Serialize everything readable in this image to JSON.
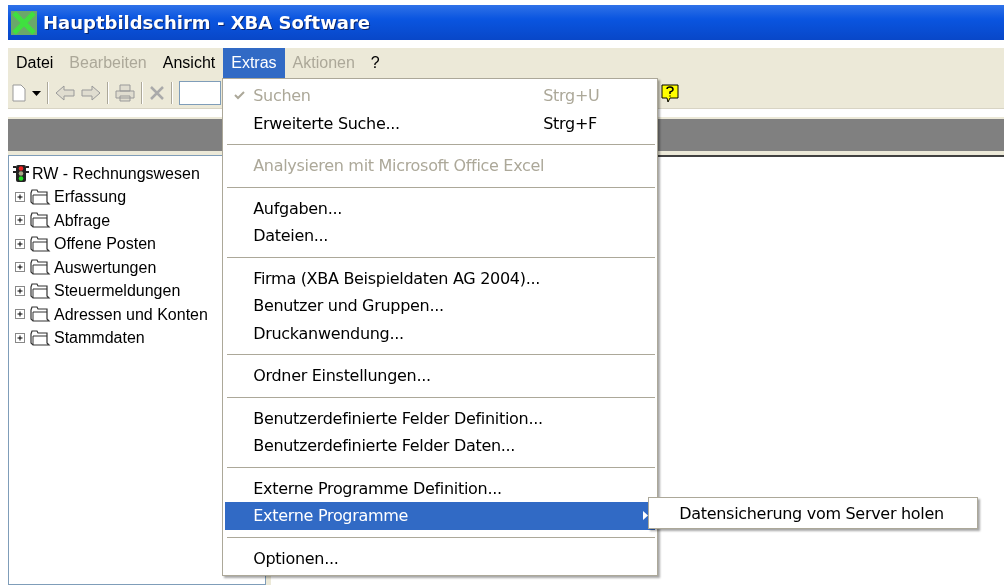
{
  "window": {
    "title": "Hauptbildschirm - XBA Software"
  },
  "menu_bar": [
    {
      "label": "Datei",
      "disabled": false,
      "selected": false
    },
    {
      "label": "Bearbeiten",
      "disabled": true,
      "selected": false
    },
    {
      "label": "Ansicht",
      "disabled": false,
      "selected": false
    },
    {
      "label": "Extras",
      "disabled": false,
      "selected": true
    },
    {
      "label": "Aktionen",
      "disabled": true,
      "selected": false
    },
    {
      "label": "?",
      "disabled": false,
      "selected": false
    }
  ],
  "extras_menu": [
    {
      "kind": "item",
      "label": "Suchen",
      "shortcut": "Strg+U",
      "disabled": true,
      "checked": true,
      "selected": false,
      "submenu": false
    },
    {
      "kind": "item",
      "label": "Erweiterte Suche...",
      "shortcut": "Strg+F",
      "disabled": false,
      "checked": false,
      "selected": false,
      "submenu": false
    },
    {
      "kind": "separator"
    },
    {
      "kind": "item",
      "label": "Analysieren mit Microsoft Office Excel",
      "disabled": true,
      "checked": false,
      "selected": false,
      "submenu": false
    },
    {
      "kind": "separator"
    },
    {
      "kind": "item",
      "label": "Aufgaben...",
      "disabled": false,
      "checked": false,
      "selected": false,
      "submenu": false
    },
    {
      "kind": "item",
      "label": "Dateien...",
      "disabled": false,
      "checked": false,
      "selected": false,
      "submenu": false
    },
    {
      "kind": "separator"
    },
    {
      "kind": "item",
      "label": "Firma (XBA Beispieldaten AG 2004)...",
      "disabled": false,
      "checked": false,
      "selected": false,
      "submenu": false
    },
    {
      "kind": "item",
      "label": "Benutzer und Gruppen...",
      "disabled": false,
      "checked": false,
      "selected": false,
      "submenu": false
    },
    {
      "kind": "item",
      "label": "Druckanwendung...",
      "disabled": false,
      "checked": false,
      "selected": false,
      "submenu": false
    },
    {
      "kind": "separator"
    },
    {
      "kind": "item",
      "label": "Ordner Einstellungen...",
      "disabled": false,
      "checked": false,
      "selected": false,
      "submenu": false
    },
    {
      "kind": "separator"
    },
    {
      "kind": "item",
      "label": "Benutzerdefinierte Felder Definition...",
      "disabled": false,
      "checked": false,
      "selected": false,
      "submenu": false
    },
    {
      "kind": "item",
      "label": "Benutzerdefinierte Felder Daten...",
      "disabled": false,
      "checked": false,
      "selected": false,
      "submenu": false
    },
    {
      "kind": "separator"
    },
    {
      "kind": "item",
      "label": "Externe Programme Definition...",
      "disabled": false,
      "checked": false,
      "selected": false,
      "submenu": false
    },
    {
      "kind": "item",
      "label": "Externe Programme",
      "disabled": false,
      "checked": false,
      "selected": true,
      "submenu": true
    },
    {
      "kind": "separator"
    },
    {
      "kind": "item",
      "label": "Optionen...",
      "disabled": false,
      "checked": false,
      "selected": false,
      "submenu": false
    }
  ],
  "submenu": [
    {
      "label": "Datensicherung vom Server holen"
    }
  ],
  "tree": {
    "label": "RW - Rechnungswesen",
    "children": [
      {
        "label": "Erfassung",
        "expanded": false
      },
      {
        "label": "Abfrage",
        "expanded": false
      },
      {
        "label": "Offene Posten",
        "expanded": false
      },
      {
        "label": "Auswertungen",
        "expanded": false
      },
      {
        "label": "Steuermeldungen",
        "expanded": false
      },
      {
        "label": "Adressen und Konten",
        "expanded": false
      },
      {
        "label": "Stammdaten",
        "expanded": false
      }
    ]
  }
}
